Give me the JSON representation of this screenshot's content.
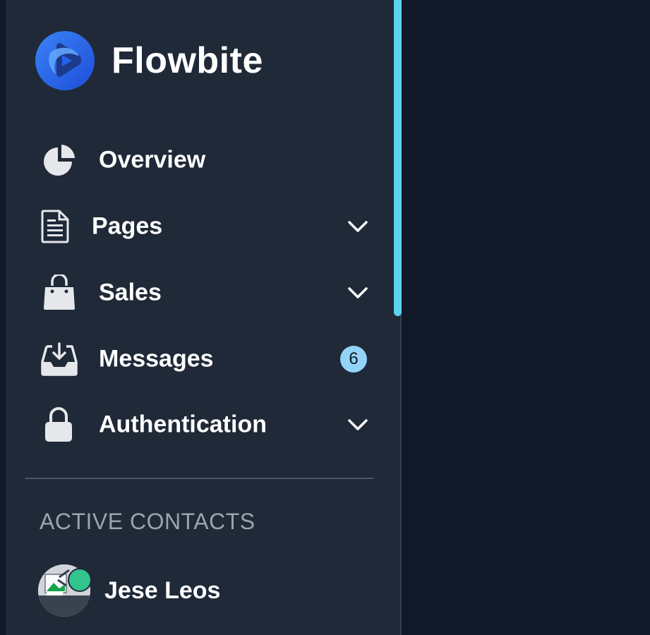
{
  "brand": {
    "name": "Flowbite",
    "logo_icon": "flowbite-logo-icon"
  },
  "nav": {
    "items": [
      {
        "label": "Overview",
        "icon": "chart-pie-icon",
        "has_dropdown": false
      },
      {
        "label": "Pages",
        "icon": "document-icon",
        "has_dropdown": true
      },
      {
        "label": "Sales",
        "icon": "shopping-bag-icon",
        "has_dropdown": true
      },
      {
        "label": "Messages",
        "icon": "inbox-in-icon",
        "has_dropdown": false,
        "badge": "6"
      },
      {
        "label": "Authentication",
        "icon": "lock-icon",
        "has_dropdown": true
      }
    ]
  },
  "contacts": {
    "section_title": "ACTIVE CONTACTS",
    "items": [
      {
        "name": "Jese Leos",
        "status": "online"
      }
    ]
  },
  "colors": {
    "sidebar_bg": "#1f2937",
    "page_bg": "#111827",
    "scrollbar": "#5bd3ee",
    "badge_bg": "#93d3f8",
    "online": "#31c48d"
  }
}
